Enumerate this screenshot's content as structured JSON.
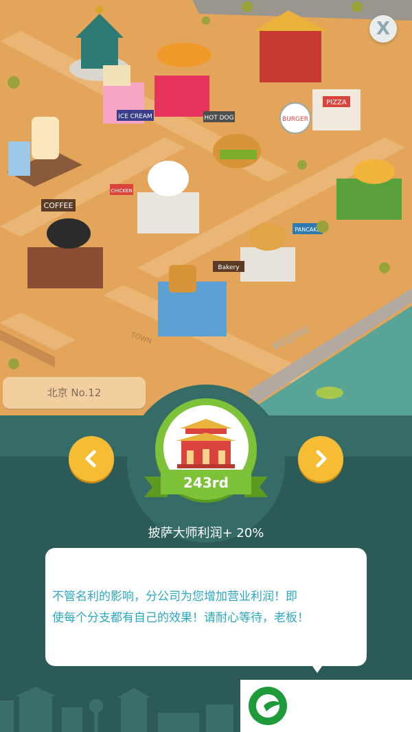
{
  "city": {
    "label": "北京 No.12"
  },
  "close": {
    "label": "X"
  },
  "map_signs": {
    "coffee": "COFFEE",
    "ice_cream": "ICE CREAM",
    "hot_dog": "HOT DOG",
    "burger": "BURGER",
    "pizza": "PIZZA",
    "chicken": "CHICKEN",
    "pancake": "PANCAKE",
    "bakery": "Bakery",
    "town": "TOWN",
    "beijing": "BEIJING"
  },
  "rank": {
    "value": "243rd"
  },
  "bonus": {
    "text": "披萨大师利润+ 20%"
  },
  "message": {
    "line1": "不管名利的影响，分公司为您增加营业利润！即",
    "line2": "使每个分支都有自己的效果！请耐心等待，老板！"
  },
  "colors": {
    "map_ground": "#e2a55a",
    "panel_bg": "#2c5a58",
    "nav_yellow": "#f6bd34",
    "emblem_green": "#7ec23a",
    "message_text": "#2aa7c0"
  },
  "icons": {
    "prev": "chevron-left-icon",
    "next": "chevron-right-icon",
    "emblem": "palace-gate-icon",
    "logo": "green-g-logo"
  }
}
